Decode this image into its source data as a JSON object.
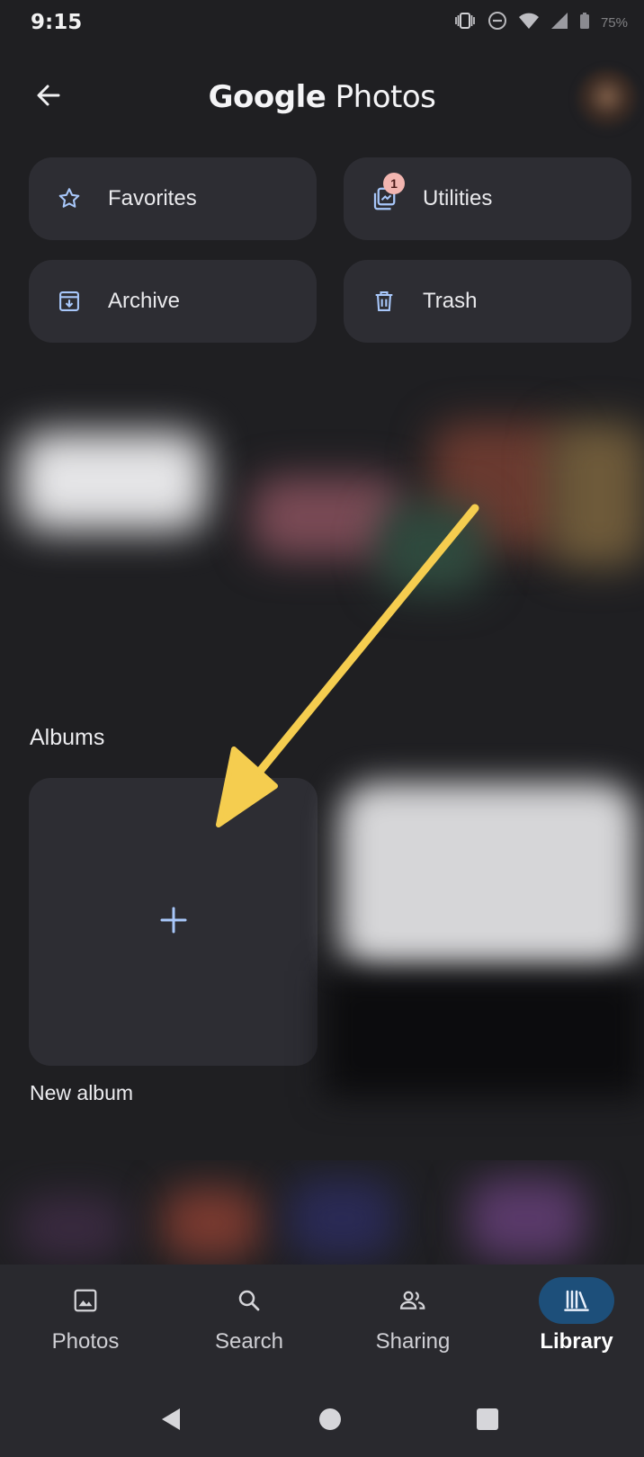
{
  "status_bar": {
    "time": "9:15",
    "battery_text": "75%",
    "icons": [
      "vibrate-icon",
      "dnd-icon",
      "wifi-icon",
      "signal-icon",
      "battery-icon"
    ]
  },
  "app_bar": {
    "title_brand": "Google",
    "title_product": "Photos",
    "back_icon": "arrow-back-icon"
  },
  "quick_actions": [
    {
      "label": "Favorites",
      "icon": "star-outline-icon"
    },
    {
      "label": "Utilities",
      "icon": "utilities-icon",
      "badge": "1"
    },
    {
      "label": "Archive",
      "icon": "archive-icon"
    },
    {
      "label": "Trash",
      "icon": "trash-icon"
    }
  ],
  "albums": {
    "section_title": "Albums",
    "new_album_label": "New album"
  },
  "bottom_nav": {
    "items": [
      {
        "label": "Photos",
        "icon": "photo-icon",
        "active": false
      },
      {
        "label": "Search",
        "icon": "search-icon",
        "active": false
      },
      {
        "label": "Sharing",
        "icon": "people-icon",
        "active": false
      },
      {
        "label": "Library",
        "icon": "library-icon",
        "active": true
      }
    ]
  },
  "system_nav": {
    "buttons": [
      "back-triangle-icon",
      "home-circle-icon",
      "recents-square-icon"
    ]
  },
  "colors": {
    "background": "#1f1f22",
    "card": "#2d2d33",
    "icon_accent": "#a8c7fa",
    "active_pill": "#1d4f7a",
    "annotation_arrow": "#f5cd4f",
    "badge": "#f2b5b0"
  }
}
